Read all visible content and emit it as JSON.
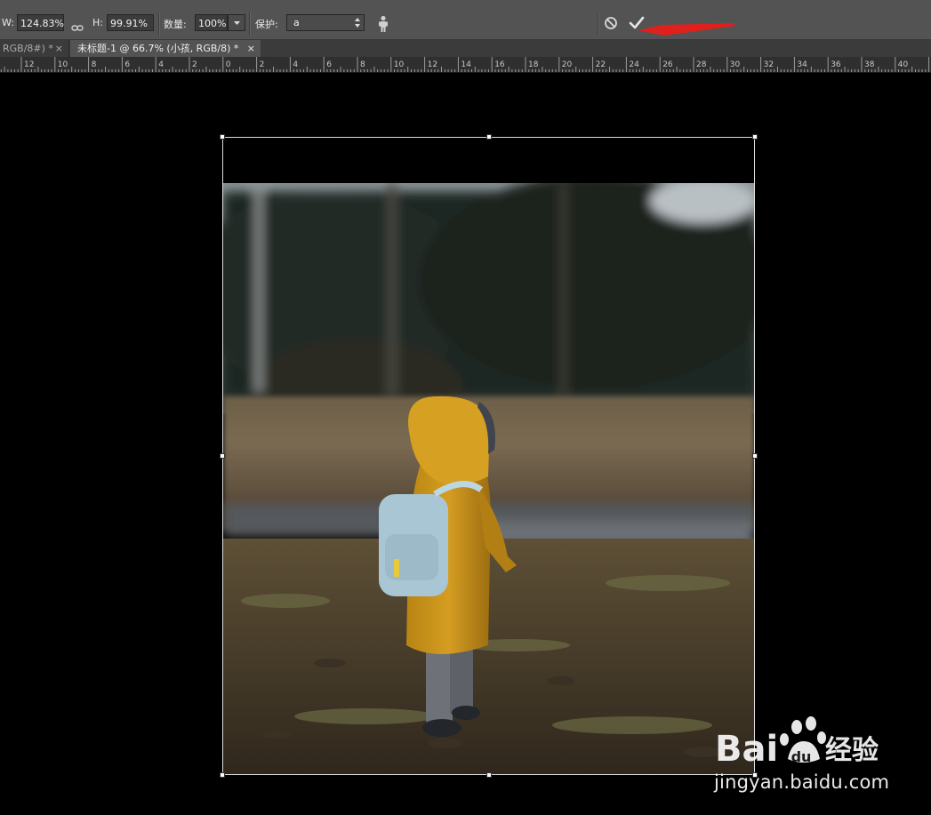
{
  "options_bar": {
    "width_label": "W:",
    "width_value": "124.83%",
    "height_label": "H:",
    "height_value": "99.91%",
    "amount_label": "数量:",
    "amount_value": "100%",
    "protect_label": "保护:",
    "protect_value": "a",
    "icons": [
      "link-icon",
      "person-icon",
      "cancel-icon",
      "commit-check-icon"
    ]
  },
  "tabs": [
    {
      "label": "RGB/8#) *",
      "close": "×",
      "active": false
    },
    {
      "label": "未标题-1 @ 66.7% (小孩, RGB/8) *",
      "close": "×",
      "active": true
    }
  ],
  "ruler": {
    "labels": [
      "12",
      "10",
      "8",
      "6",
      "4",
      "2",
      "0",
      "2",
      "4",
      "6",
      "8",
      "10",
      "12",
      "14",
      "16",
      "18",
      "20",
      "22",
      "24",
      "26",
      "28",
      "30",
      "32",
      "34",
      "36",
      "38",
      "40"
    ]
  },
  "annotation": {
    "arrow_color": "#e0201c"
  },
  "watermark": {
    "logo_text": "Bai 经验",
    "url": "jingyan.baidu.com"
  }
}
